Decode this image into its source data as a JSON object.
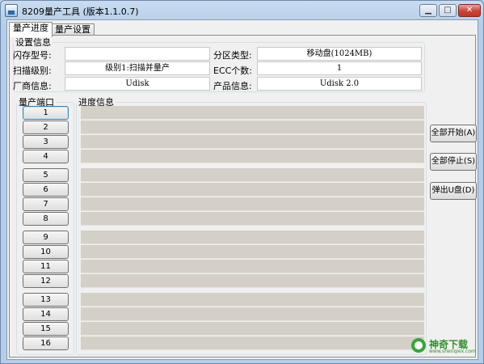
{
  "window": {
    "title": "8209量产工具 (版本1.1.0.7)",
    "controls": {
      "minimize": "▁",
      "maximize": "□",
      "close": "✕"
    }
  },
  "tabs": [
    {
      "label": "量产进度",
      "active": true
    },
    {
      "label": "量产设置",
      "active": false
    }
  ],
  "settings": {
    "legend": "设置信息",
    "flash_type_label": "闪存型号:",
    "flash_type_value": "",
    "partition_label": "分区类型:",
    "partition_value": "移动盘(1024MB)",
    "scan_level_label": "扫描级别:",
    "scan_level_value": "级别1:扫描并量产",
    "ecc_label": "ECC个数:",
    "ecc_value": "1",
    "vendor_label": "厂商信息:",
    "vendor_value": "Udisk",
    "product_label": "产品信息:",
    "product_value": "Udisk 2.0"
  },
  "ports": {
    "legend": "量产端口",
    "buttons": [
      "1",
      "2",
      "3",
      "4",
      "5",
      "6",
      "7",
      "8",
      "9",
      "10",
      "11",
      "12",
      "13",
      "14",
      "15",
      "16"
    ]
  },
  "progress": {
    "legend": "进度信息",
    "rows": 16
  },
  "actions": {
    "start_all": "全部开始(A)",
    "stop_all": "全部停止(S)",
    "eject": "弹出U盘(D)"
  },
  "watermark": {
    "name": "神奇下载",
    "url": "www.shenqiex.com"
  }
}
